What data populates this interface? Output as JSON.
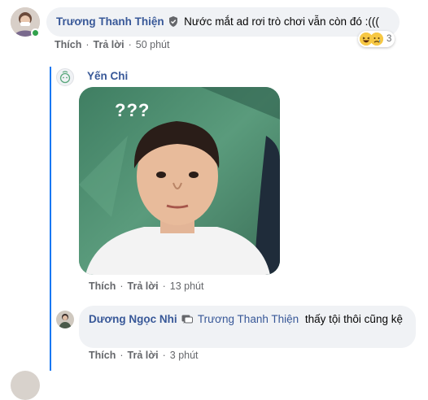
{
  "comment1": {
    "author": "Trương Thanh Thiện",
    "text": "Nước mắt ad rơi trò chơi vẫn còn đó :(((",
    "reaction_count": "3",
    "like_label": "Thích",
    "reply_label": "Trả lời",
    "time": "50 phút"
  },
  "reply1": {
    "author": "Yến Chi",
    "image_caption": "???",
    "like_label": "Thích",
    "reply_label": "Trả lời",
    "time": "13 phút"
  },
  "reply2": {
    "author": "Dương Ngọc Nhi",
    "mention": "Trương Thanh Thiện",
    "text": "thấy tội thôi cũng kệ",
    "like_label": "Thích",
    "reply_label": "Trả lời",
    "time": "3 phút"
  },
  "colors": {
    "link": "#385898",
    "thread_line": "#1877f2",
    "bubble": "#f0f2f5",
    "online": "#31a24c"
  }
}
